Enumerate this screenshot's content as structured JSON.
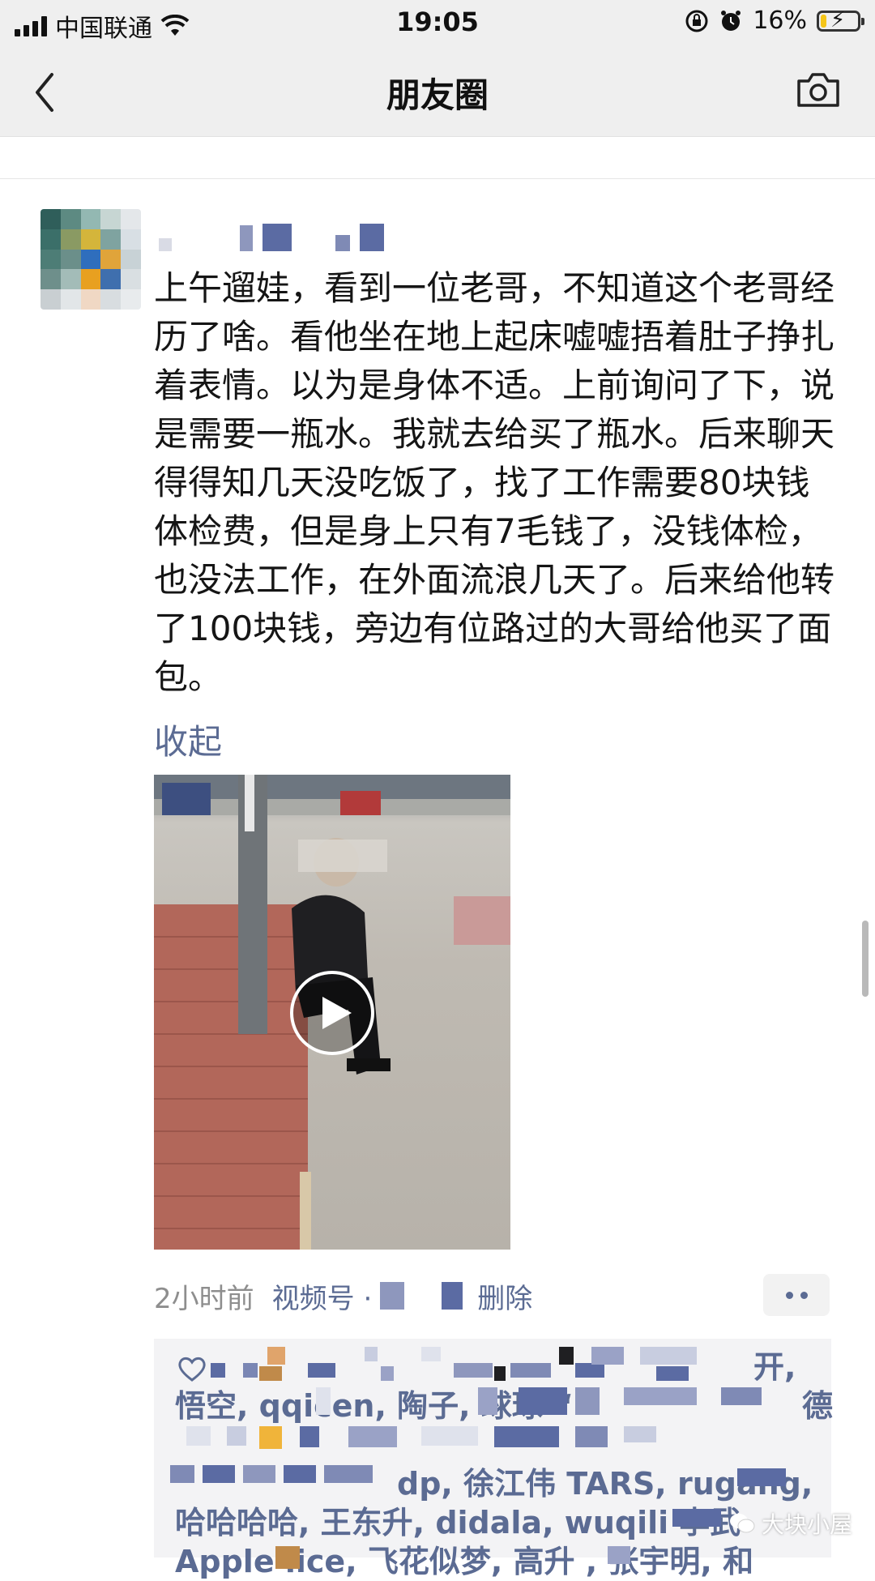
{
  "status_bar": {
    "carrier": "中国联通",
    "time": "19:05",
    "battery_percent": "16%",
    "battery_level": 0.16
  },
  "nav": {
    "title": "朋友圈"
  },
  "post": {
    "text": "上午遛娃，看到一位老哥，不知道这个老哥经历了啥。看他坐在地上起床嘘嘘捂着肚子挣扎着表情。以为是身体不适。上前询问了下，说是需要一瓶水。我就去给买了瓶水。后来聊天得得知几天没吃饭了，找了工作需要80块钱体检费，但是身上只有7毛钱了，没钱体检，也没法工作，在外面流浪几天了。后来给他转了100块钱，旁边有位路过的大哥给他买了面包。",
    "collapse_label": "收起",
    "time_ago": "2小时前",
    "channel_label": "视频号 ·",
    "delete_label": "删除"
  },
  "likes": {
    "line1_end": "开,",
    "line2_a": "悟空, qqicen, 陶子, 球球 “",
    "line2_end": "德",
    "line3": "",
    "line4": "dp, 徐江伟 TARS, rugang,",
    "line5": "哈哈哈哈, 王东升, didala, wuqili 李武",
    "line6": "Apple    lice, 飞花似梦, 高升    , 张宇明, 和"
  },
  "watermark": {
    "text": "大块小屋"
  },
  "colors": {
    "link": "#5b6b93",
    "background": "#ffffff",
    "nav_bg": "#efefef",
    "likes_bg": "#f3f3f5"
  }
}
